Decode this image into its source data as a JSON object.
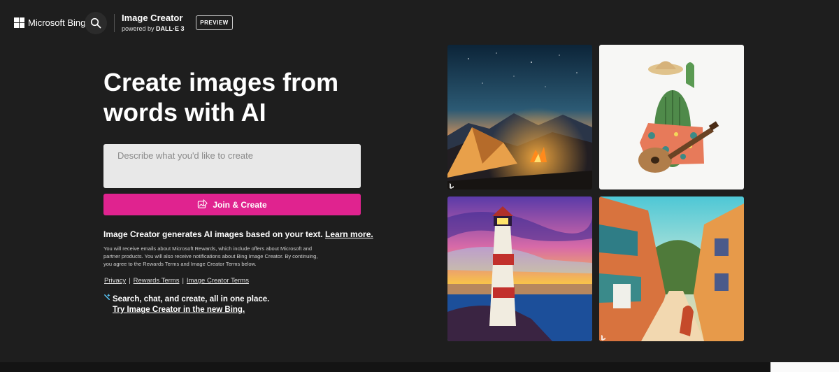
{
  "header": {
    "brand": "Microsoft Bing",
    "product_title": "Image Creator",
    "product_powered_prefix": "powered by",
    "product_powered_model": "DALL·E 3",
    "preview_badge": "PREVIEW",
    "search_icon": "search-icon",
    "logo_icon": "microsoft-logo-icon"
  },
  "hero": {
    "line1": "Create images from",
    "line2": "words with AI"
  },
  "prompt": {
    "placeholder": "Describe what you'd like to create",
    "value": ""
  },
  "join_button": {
    "label": "Join & Create",
    "icon": "create-image-icon",
    "color": "#e0238f"
  },
  "info": {
    "text": "Image Creator generates AI images based on your text.",
    "learn_more": "Learn more."
  },
  "legal": "You will receive emails about Microsoft Rewards, which include offers about Microsoft and partner products. You will also receive notifications about Bing Image Creator. By continuing, you agree to the Rewards Terms and Image Creator Terms below.",
  "links": {
    "privacy": "Privacy",
    "rewards_terms": "Rewards Terms",
    "creator_terms": "Image Creator Terms",
    "separator": "|"
  },
  "promo": {
    "line1": "Search, chat, and create, all in one place.",
    "line2": "Try Image Creator in the new Bing.",
    "icon": "sparkle-icon"
  },
  "gallery": [
    {
      "subject": "tent and campfire under starry night sky"
    },
    {
      "subject": "cactus with straw hat playing guitar"
    },
    {
      "subject": "lighthouse at sunset"
    },
    {
      "subject": "colorful village street"
    }
  ],
  "colors": {
    "background": "#1e1e1e",
    "accent": "#e0238f"
  }
}
